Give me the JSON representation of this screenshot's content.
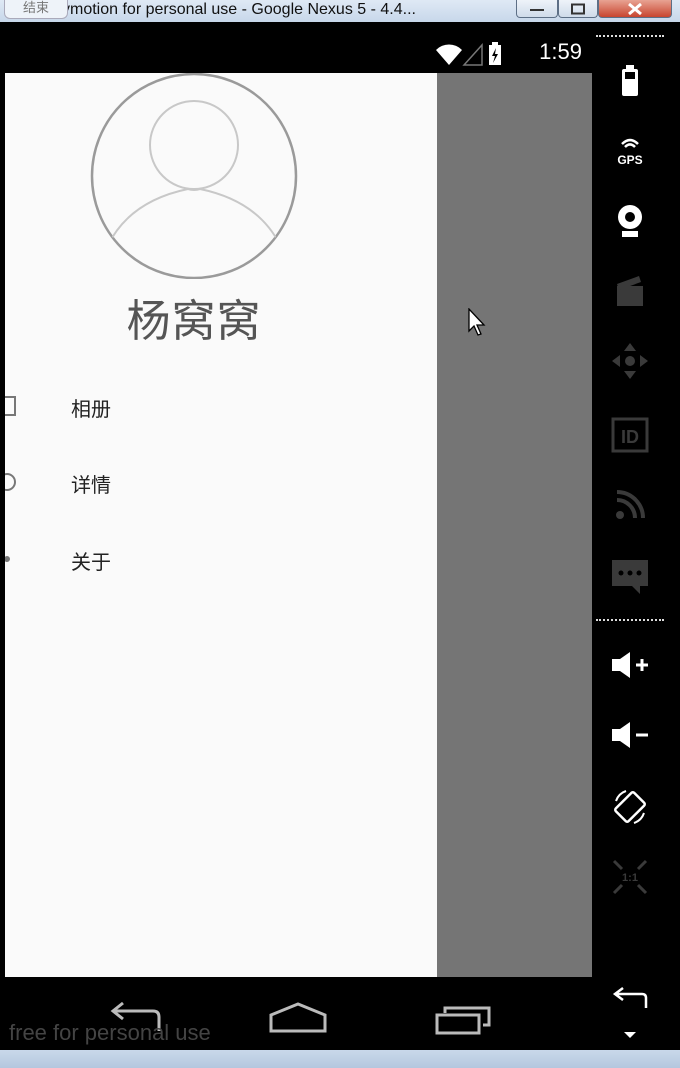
{
  "window": {
    "title": "ymotion for personal use - Google Nexus 5 - 4.4...",
    "end_tab_label": "结束"
  },
  "status_bar": {
    "time": "1:59",
    "icons": [
      "wifi-icon",
      "signal-icon",
      "battery-charging-icon"
    ]
  },
  "drawer": {
    "username": "杨窝窝",
    "menu": [
      {
        "label": "相册",
        "icon": "album-icon"
      },
      {
        "label": "详情",
        "icon": "info-icon"
      },
      {
        "label": "关于",
        "icon": "about-icon"
      }
    ]
  },
  "nav_bar": {
    "buttons": [
      "back-icon",
      "home-icon",
      "recents-icon"
    ],
    "watermark": "free for personal use"
  },
  "side_panel": {
    "tools": [
      "battery-icon",
      "gps-icon",
      "webcam-icon",
      "clapperboard-icon",
      "dpad-icon",
      "id-icon",
      "rss-icon",
      "sms-icon",
      "volume-up-icon",
      "volume-down-icon",
      "rotate-icon",
      "scale-icon",
      "back-icon",
      "menu-icon"
    ],
    "gps_label": "GPS",
    "id_label": "ID",
    "scale_label": "1:1"
  },
  "colors": {
    "drawer_bg": "#fafafa",
    "scrim": "#757575",
    "text": "#555555"
  }
}
